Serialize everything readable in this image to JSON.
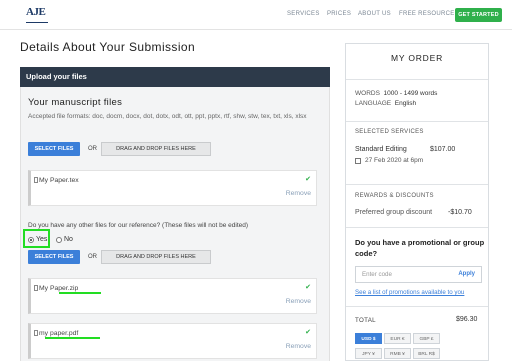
{
  "nav": {
    "logo": "AJE",
    "links": [
      "SERVICES",
      "PRICES",
      "ABOUT US",
      "FREE RESOURCES"
    ],
    "cta": "GET STARTED"
  },
  "page_title": "Details About Your Submission",
  "upload": {
    "header": "Upload your files",
    "section_title": "Your manuscript files",
    "formats": "Accepted file formats: doc, docm, docx, dot, dotx, odt, ott, ppt, pptx, rtf, shw, stw, tex, txt, xls, xlsx",
    "select_label": "SELECT FILES",
    "or_label": "OR",
    "drag_label": "DRAG AND DROP FILES HERE",
    "manuscript_file": "My Paper.tex",
    "remove_label": "Remove",
    "question": "Do you have any other files for our reference? (These files will not be edited)",
    "yes_label": "Yes",
    "no_label": "No",
    "ref_files": [
      "My Paper.zip",
      "my paper.pdf"
    ]
  },
  "order": {
    "title": "MY ORDER",
    "words_label": "WORDS",
    "words_value": "1000 - 1499 words",
    "language_label": "LANGUAGE",
    "language_value": "English",
    "selected_services_label": "SELECTED SERVICES",
    "service_name": "Standard Editing",
    "service_price": "$107.00",
    "service_date": "27 Feb 2020 at 6pm",
    "rewards_label": "REWARDS & DISCOUNTS",
    "discount_name": "Preferred group discount",
    "discount_value": "-$10.70",
    "promo_question": "Do you have a promotional or group code?",
    "promo_placeholder": "Enter code",
    "apply_label": "Apply",
    "promo_link": "See a list of promotions available to you",
    "total_label": "TOTAL",
    "total_value": "$96.30",
    "currencies": [
      "USD $",
      "EUR €",
      "GBP £",
      "JPY ¥",
      "RMB ¥",
      "BRL R$"
    ]
  },
  "colors": {
    "header_bg": "#2d3a4a",
    "primary_button": "#3b7fd9",
    "cta_green": "#2fb04b",
    "annotation_green": "#22dd22"
  }
}
